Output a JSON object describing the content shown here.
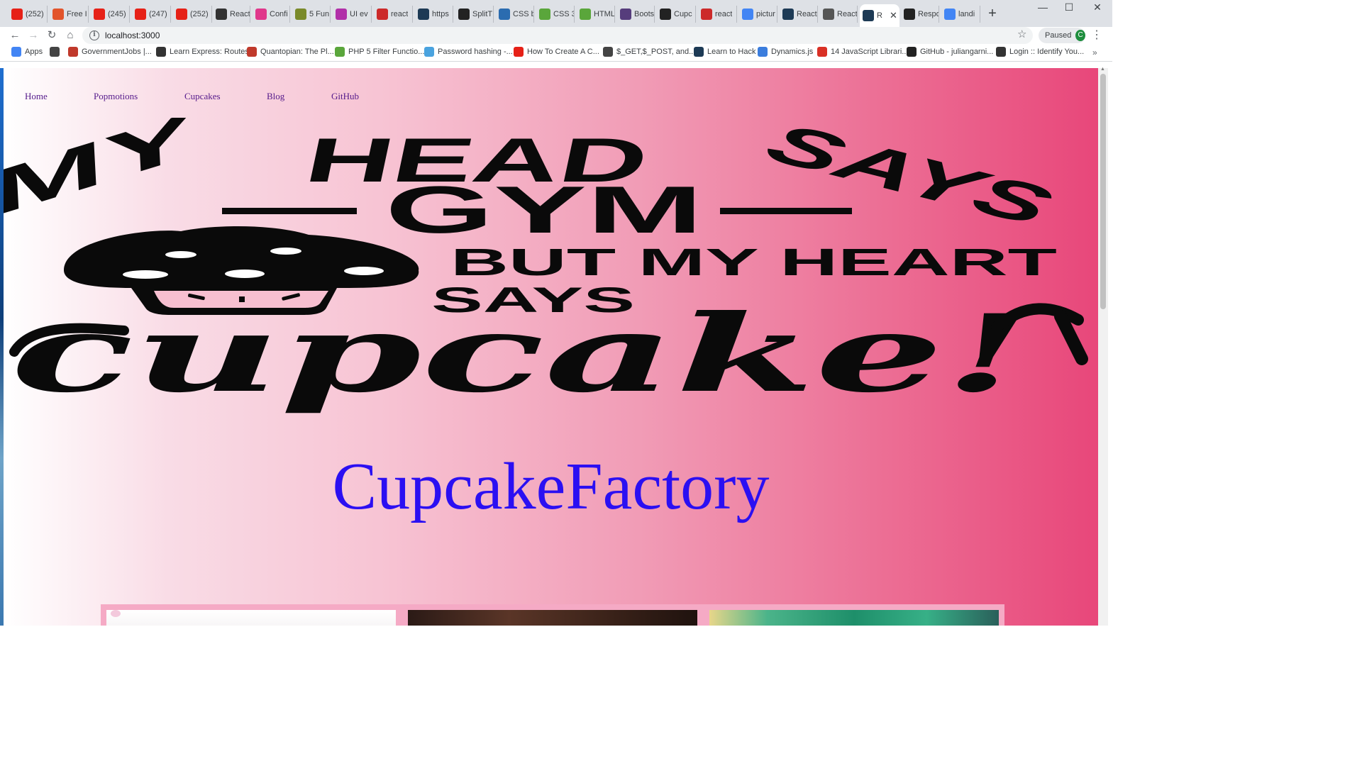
{
  "browser": {
    "tabs": [
      {
        "title": "(252)",
        "icon": "youtube-icon",
        "color": "#e62117"
      },
      {
        "title": "Free I",
        "icon": "feather-icon",
        "color": "#e2542b"
      },
      {
        "title": "(245)",
        "icon": "youtube-icon",
        "color": "#e62117"
      },
      {
        "title": "(247)",
        "icon": "youtube-icon",
        "color": "#e62117"
      },
      {
        "title": "(252)",
        "icon": "youtube-icon",
        "color": "#e62117"
      },
      {
        "title": "React",
        "icon": "cube-icon",
        "color": "#333333"
      },
      {
        "title": "Confi",
        "icon": "c-icon",
        "color": "#e0378b"
      },
      {
        "title": "5 Fun",
        "icon": "leaf-icon",
        "color": "#7a8a2a"
      },
      {
        "title": "UI ev",
        "icon": "c-icon",
        "color": "#b12fa8"
      },
      {
        "title": "react",
        "icon": "t-icon",
        "color": "#cc2a2a"
      },
      {
        "title": "https",
        "icon": "grid-icon",
        "color": "#1d3a55"
      },
      {
        "title": "SplitT",
        "icon": "split-icon",
        "color": "#222222"
      },
      {
        "title": "CSS b",
        "icon": "css-icon",
        "color": "#2b6cb0"
      },
      {
        "title": "CSS 3",
        "icon": "w3-icon",
        "color": "#5aa63b"
      },
      {
        "title": "HTML",
        "icon": "w3-icon",
        "color": "#5aa63b"
      },
      {
        "title": "Boots",
        "icon": "bootstrap-icon",
        "color": "#563d7c"
      },
      {
        "title": "Cupc",
        "icon": "cupcake-icon",
        "color": "#222222"
      },
      {
        "title": "react",
        "icon": "t-icon",
        "color": "#cc2a2a"
      },
      {
        "title": "pictur",
        "icon": "google-icon",
        "color": "#4285f4"
      },
      {
        "title": "React",
        "icon": "grid-icon",
        "color": "#1d3a55"
      },
      {
        "title": "React",
        "icon": "globe-icon",
        "color": "#555555"
      },
      {
        "title": "R",
        "icon": "grid-icon",
        "color": "#1d3a55",
        "active": true
      },
      {
        "title": "Respo",
        "icon": "cube-icon",
        "color": "#222222"
      },
      {
        "title": "landi",
        "icon": "google-icon",
        "color": "#4285f4"
      }
    ],
    "new_tab": "+",
    "window_controls": {
      "minimize": "—",
      "maximize": "☐",
      "close": "✕"
    },
    "tab_close": "✕",
    "back": "←",
    "forward": "→",
    "reload": "↻",
    "home": "⌂",
    "info_glyph": "i",
    "url": "localhost:3000",
    "star": "☆",
    "profile_status": "Paused",
    "profile_initial": "C",
    "menu": "⋮",
    "bookmarks": [
      {
        "label": "Apps",
        "icon": "apps-grid-icon",
        "color": "#4285f4"
      },
      {
        "label": "",
        "icon": "globe-icon",
        "color": "#444444"
      },
      {
        "label": "GovernmentJobs |...",
        "icon": "gov-icon",
        "color": "#c0392b"
      },
      {
        "label": "Learn Express: Routes",
        "icon": "c-icon",
        "color": "#333333"
      },
      {
        "label": "Quantopian: The Pl...",
        "icon": "q-icon",
        "color": "#c0392b"
      },
      {
        "label": "PHP 5 Filter Functio...",
        "icon": "w3-icon",
        "color": "#5aa63b"
      },
      {
        "label": "Password hashing -...",
        "icon": "php-icon",
        "color": "#4aa3df"
      },
      {
        "label": "How To Create A C...",
        "icon": "youtube-icon",
        "color": "#e62117"
      },
      {
        "label": "$_GET,$_POST, and...",
        "icon": "globe-icon",
        "color": "#444444"
      },
      {
        "label": "Learn to Hack",
        "icon": "h-icon",
        "color": "#1d3a55"
      },
      {
        "label": "Dynamics.js",
        "icon": "dynamics-icon",
        "color": "#3b7ddd"
      },
      {
        "label": "14 JavaScript Librari...",
        "icon": "r-icon",
        "color": "#d93025"
      },
      {
        "label": "GitHub - juliangarni...",
        "icon": "github-icon",
        "color": "#222222"
      },
      {
        "label": "Login :: Identify You...",
        "icon": "login-icon",
        "color": "#333333"
      }
    ],
    "bookmarks_more": "»"
  },
  "site": {
    "nav": [
      "Home",
      "Popmotions",
      "Cupcakes",
      "Blog",
      "GitHub"
    ],
    "hero_text": {
      "line1_words": [
        "MY",
        "HEAD",
        "SAYS"
      ],
      "line2": "GYM",
      "line3": "BUT MY HEART",
      "line4": "SAYS",
      "script": "cupcake!"
    },
    "brand": "CupcakeFactory"
  },
  "colors": {
    "gradient_start": "#ffffff",
    "gradient_end": "#e8477a",
    "brand_text": "#2b0ff2",
    "nav_link": "#551a8b",
    "gallery_bg": "#f5aac5"
  }
}
